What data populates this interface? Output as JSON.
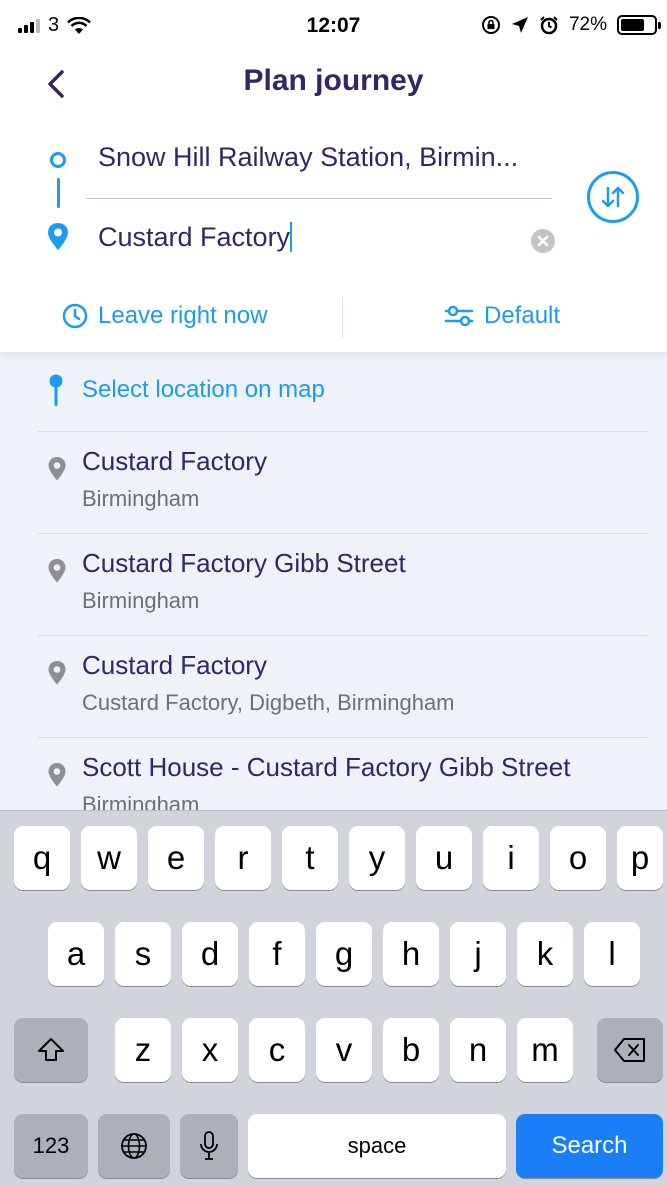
{
  "status_bar": {
    "carrier": "3",
    "time": "12:07",
    "battery_pct": "72%",
    "battery_level": 0.72,
    "icons": [
      "signal-icon",
      "wifi-icon",
      "rotation-lock-icon",
      "location-arrow-icon",
      "alarm-icon",
      "battery-icon"
    ]
  },
  "header": {
    "title": "Plan journey",
    "back_icon": "chevron-left-icon"
  },
  "route": {
    "from": "Snow Hill Railway Station, Birmin...",
    "to": "Custard Factory"
  },
  "options": {
    "time_label": "Leave right now",
    "prefs_label": "Default"
  },
  "results": {
    "map_option": "Select location on map",
    "items": [
      {
        "name": "Custard Factory",
        "subtitle": "Birmingham"
      },
      {
        "name": "Custard Factory Gibb Street",
        "subtitle": "Birmingham"
      },
      {
        "name": "Custard Factory",
        "subtitle": "Custard Factory, Digbeth, Birmingham"
      },
      {
        "name": "Scott House - Custard Factory Gibb Street",
        "subtitle": "Birmingham"
      }
    ]
  },
  "keyboard": {
    "row1": [
      "q",
      "w",
      "e",
      "r",
      "t",
      "y",
      "u",
      "i",
      "o",
      "p"
    ],
    "row2": [
      "a",
      "s",
      "d",
      "f",
      "g",
      "h",
      "j",
      "k",
      "l"
    ],
    "row3": [
      "z",
      "x",
      "c",
      "v",
      "b",
      "n",
      "m"
    ],
    "numbers_label": "123",
    "space_label": "space",
    "search_label": "Search"
  },
  "colors": {
    "accent": "#1d9bf0",
    "title": "#2b2966",
    "results_bg": "#eef2f9",
    "search_key": "#1a7ff6"
  }
}
